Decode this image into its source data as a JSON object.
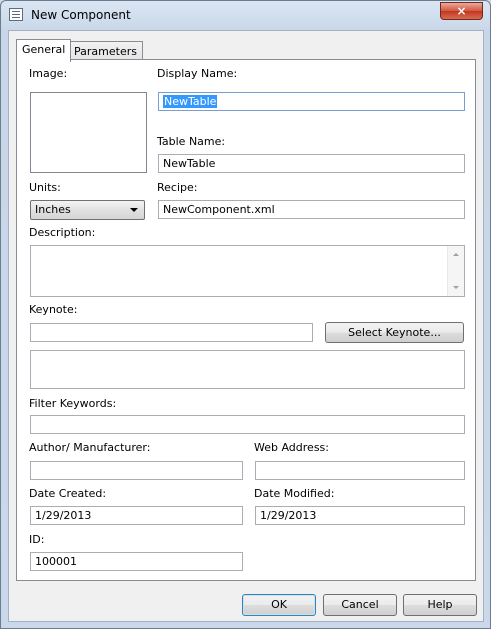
{
  "window": {
    "title": "New Component",
    "close_glyph": "×"
  },
  "tabs": [
    {
      "label": "General",
      "active": true
    },
    {
      "label": "Parameters",
      "active": false
    }
  ],
  "form": {
    "image_label": "Image:",
    "display_name_label": "Display Name:",
    "display_name_value": "NewTable",
    "table_name_label": "Table Name:",
    "table_name_value": "NewTable",
    "units_label": "Units:",
    "units_value": "Inches",
    "recipe_label": "Recipe:",
    "recipe_value": "NewComponent.xml",
    "description_label": "Description:",
    "description_value": "",
    "keynote_label": "Keynote:",
    "keynote_value": "",
    "select_keynote_button": "Select Keynote...",
    "keynote_text": "",
    "filter_keywords_label": "Filter Keywords:",
    "filter_keywords_value": "",
    "author_label": "Author/ Manufacturer:",
    "author_value": "",
    "web_address_label": "Web Address:",
    "web_address_value": "",
    "date_created_label": "Date Created:",
    "date_created_value": "1/29/2013",
    "date_modified_label": "Date Modified:",
    "date_modified_value": "1/29/2013",
    "id_label": "ID:",
    "id_value": "100001"
  },
  "buttons": {
    "ok": "OK",
    "cancel": "Cancel",
    "help": "Help"
  },
  "icons": {
    "window_icon": "table-window-icon",
    "close": "close-icon",
    "dropdown": "chevron-down-icon"
  }
}
